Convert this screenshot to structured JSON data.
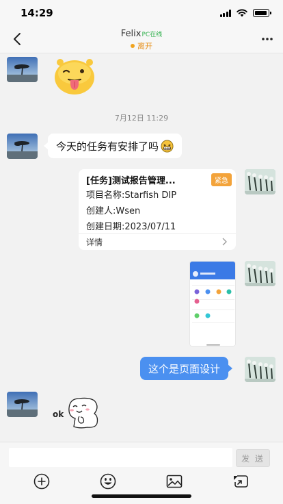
{
  "status_bar": {
    "time": "14:29"
  },
  "header": {
    "contact_name": "Felix",
    "online_tag": "PC在线",
    "presence": "离开"
  },
  "messages": {
    "timestamp": "7月12日 11:29",
    "text_1": "今天的任务有安排了吗",
    "task_card": {
      "title": "[任务]测试报告管理...",
      "badge": "紧急",
      "project": "项目名称:Starfish DIP",
      "creator": "创建人:Wsen",
      "created_date": "创建日期:2023/07/11",
      "detail": "详情"
    },
    "text_2": "这个是页面设计",
    "sticker_text": "ok"
  },
  "input_bar": {
    "placeholder": "",
    "send_label": "发 送"
  },
  "icons": {
    "back": "chevron-left-icon",
    "more": "more-dots-icon",
    "plus": "plus-circle-icon",
    "emoji": "emoji-icon",
    "image": "image-icon",
    "forward": "share-icon"
  },
  "colors": {
    "bubble_blue": "#4b90f0",
    "online_green": "#33b14f",
    "away_orange": "#f0a31e",
    "urgent_badge": "#f3a33a"
  }
}
